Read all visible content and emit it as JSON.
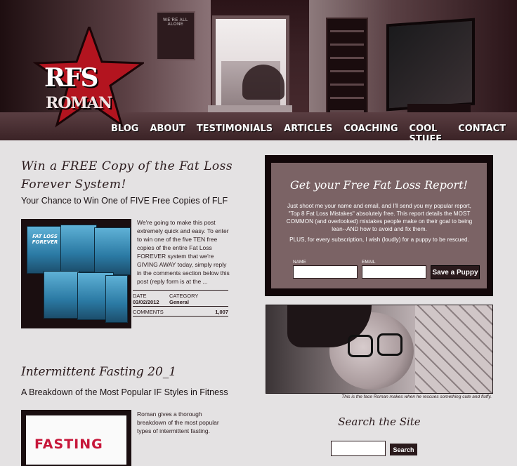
{
  "logo": {
    "line1": "RFS",
    "line2": "ROMAN"
  },
  "header": {
    "poster_text": "WE'RE ALL ALONE"
  },
  "nav": {
    "items": [
      "BLOG",
      "ABOUT",
      "TESTIMONIALS",
      "ARTICLES",
      "COACHING",
      "COOL STUFF",
      "CONTACT"
    ]
  },
  "post1": {
    "title": "Win a FREE Copy of the Fat Loss Forever System!",
    "subtitle": "Your Chance to Win One of FIVE Free Copies of FLF",
    "thumb_label": "FAT LOSS FOREVER",
    "excerpt": "We're going to make this post extremely quick and easy. To enter to win one of the five TEN free copies of the entire Fat Loss FOREVER system that we're GIVING AWAY today, simply reply in the comments section below this post (reply form is at the ...",
    "meta": {
      "date_label": "DATE",
      "date": "03/02/2012",
      "category_label": "CATEGORY",
      "category": "General",
      "comments_label": "COMMENTS",
      "comments": "1,007"
    }
  },
  "post2": {
    "title": "Intermittent Fasting 20_1",
    "subtitle": "A Breakdown of the Most Popular IF Styles in Fitness",
    "thumb_label": "FASTING",
    "excerpt": "Roman gives a thorough breakdown of the most popular types of intermittent fasting."
  },
  "optin": {
    "title": "Get your Free Fat Loss Report!",
    "body": "Just shoot me your name and email, and I'll send you my popular report, \"Top 8 Fat Loss Mistakes\" absolutely free. This report details the MOST COMMON (and overlooked) mistakes people make on their goal to being lean--AND how to avoid and fix them.",
    "body2": "PLUS, for every subscription, I wish (loudly) for a puppy to be rescued.",
    "name_label": "NAME",
    "email_label": "EMAIL",
    "button_label": "Save a Puppy"
  },
  "photo": {
    "caption": "This is the face Roman makes when he rescues something cute and fluffy."
  },
  "search": {
    "title": "Search the Site",
    "button_label": "Search"
  }
}
